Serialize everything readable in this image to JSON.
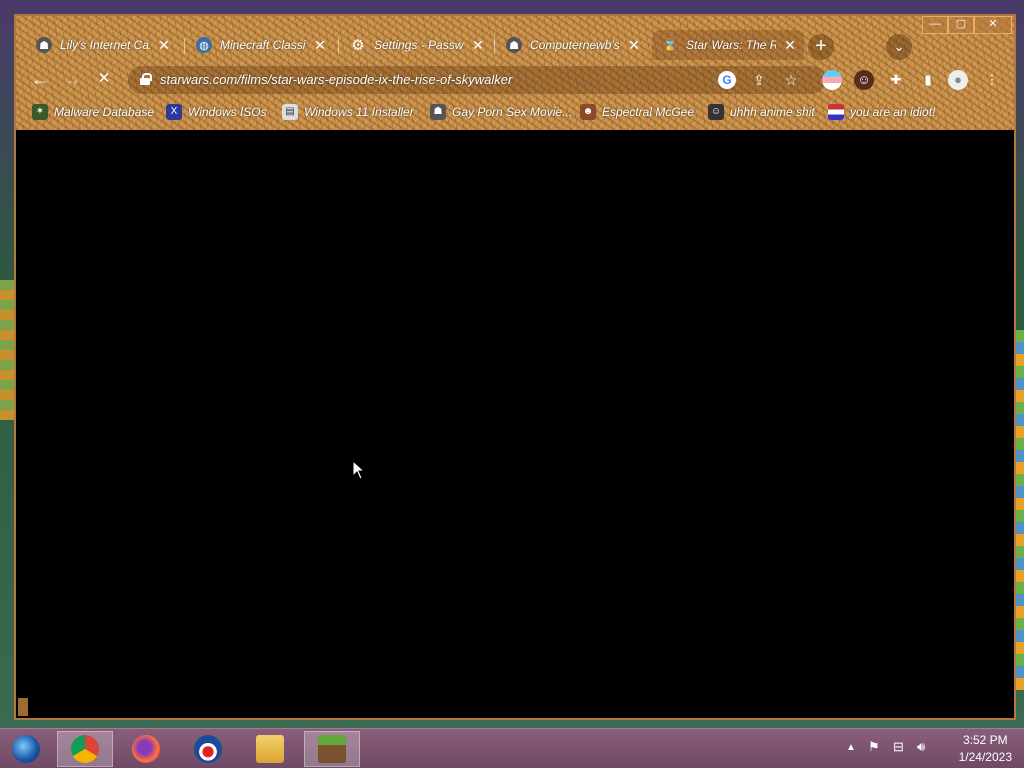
{
  "tabs": [
    {
      "title": "Lily's Internet Café",
      "icon": "custom-favicon-icon"
    },
    {
      "title": "Minecraft Classic",
      "icon": "globe-icon"
    },
    {
      "title": "Settings - Passwords",
      "icon": "gear-icon"
    },
    {
      "title": "Computernewb's",
      "icon": "custom-favicon-icon"
    },
    {
      "title": "Star Wars: The Rise of Skywalker",
      "icon": "loading-icon",
      "active": true
    }
  ],
  "toolbar": {
    "url": "starwars.com/films/star-wars-episode-ix-the-rise-of-skywalker",
    "back": "←",
    "forward": "→",
    "stop": "✕"
  },
  "bookmarks": [
    {
      "label": "Malware Database"
    },
    {
      "label": "Windows ISOs"
    },
    {
      "label": "Windows 11 Installer"
    },
    {
      "label": "Gay Porn Sex Movie..."
    },
    {
      "label": "Espectral McGee"
    },
    {
      "label": "uhhh anime shit"
    },
    {
      "label": "you are an idiot!"
    }
  ],
  "taskbar": {
    "apps": [
      "windows-start",
      "chrome",
      "firefox",
      "obama-icon",
      "file-explorer",
      "minecraft"
    ],
    "time": "3:52 PM",
    "date": "1/24/2023"
  },
  "colors": {
    "frame": "#c8904a",
    "taskbar": "#7a5470",
    "content": "#000000"
  }
}
